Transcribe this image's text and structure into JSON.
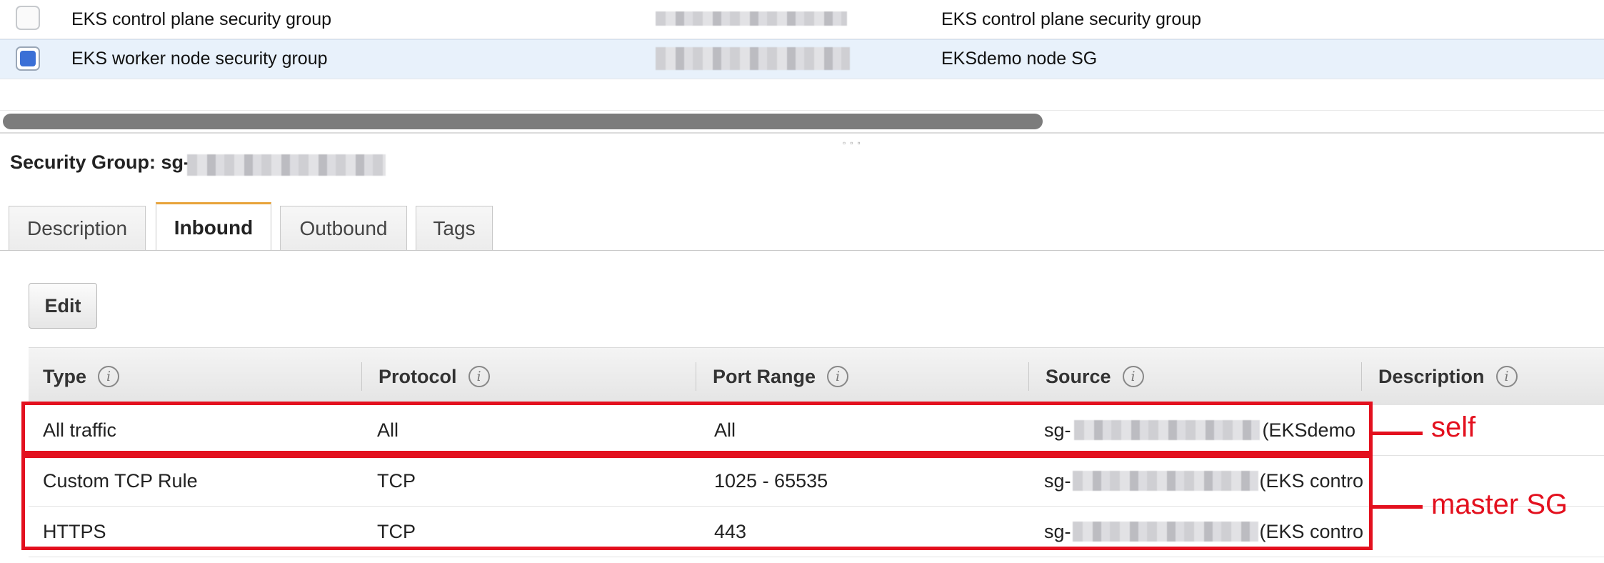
{
  "list": {
    "rows": [
      {
        "name": "EKS control plane security group",
        "description": "EKS control plane security group",
        "selected": false
      },
      {
        "name": "EKS worker node security group",
        "description": "EKSdemo node SG",
        "selected": true
      }
    ]
  },
  "details": {
    "title_prefix": "Security Group: sg-"
  },
  "tabs": [
    {
      "label": "Description",
      "active": false
    },
    {
      "label": "Inbound",
      "active": true
    },
    {
      "label": "Outbound",
      "active": false
    },
    {
      "label": "Tags",
      "active": false
    }
  ],
  "actions": {
    "edit_label": "Edit"
  },
  "table": {
    "headers": [
      "Type",
      "Protocol",
      "Port Range",
      "Source",
      "Description"
    ],
    "info_glyph": "i",
    "rows": [
      {
        "type": "All traffic",
        "protocol": "All",
        "port_range": "All",
        "source_prefix": "sg-",
        "source_suffix": "(EKSdemo"
      },
      {
        "type": "Custom TCP Rule",
        "protocol": "TCP",
        "port_range": "1025 - 65535",
        "source_prefix": "sg-",
        "source_suffix": "(EKS contro"
      },
      {
        "type": "HTTPS",
        "protocol": "TCP",
        "port_range": "443",
        "source_prefix": "sg-",
        "source_suffix": "(EKS contro"
      }
    ]
  },
  "annotations": {
    "self_label": "self",
    "master_label": "master SG",
    "color": "#e3101e"
  },
  "colors": {
    "selected_row": "#e8f1fb",
    "checkbox_checked": "#3a6fd6",
    "active_tab_accent": "#e8a33a"
  }
}
